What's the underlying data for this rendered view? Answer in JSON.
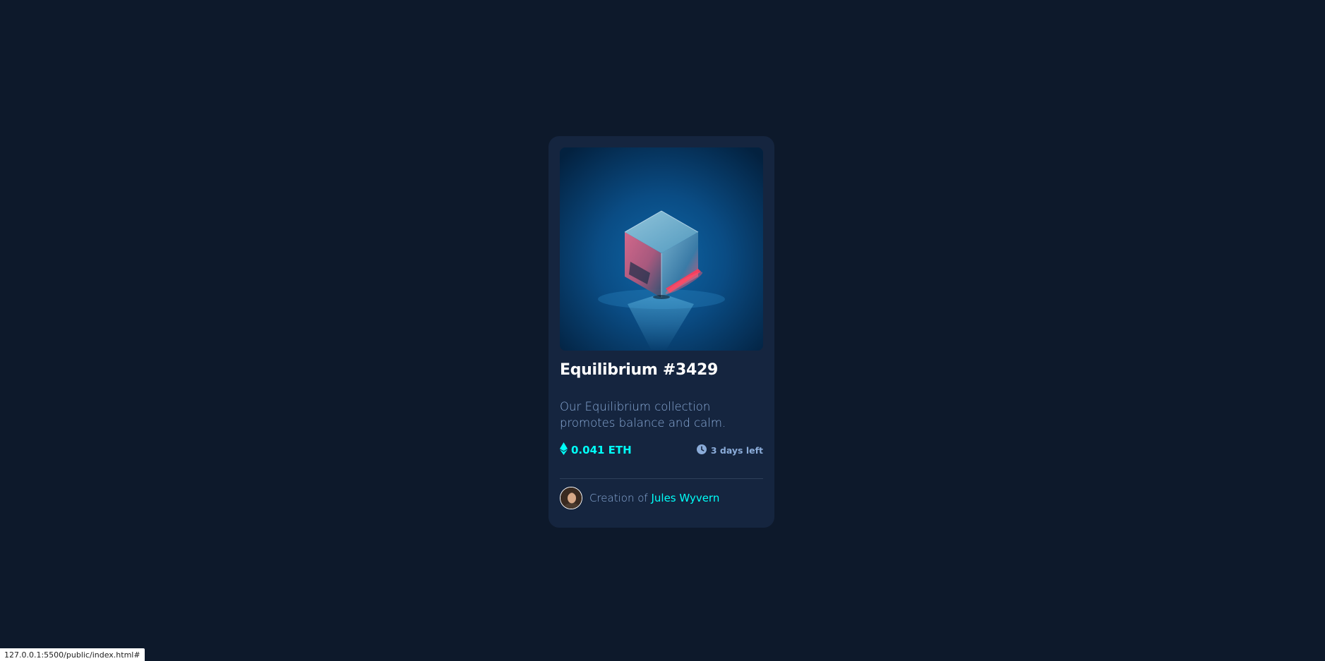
{
  "card": {
    "title": "Equilibrium #3429",
    "description": "Our Equilibrium collection promotes balance and calm.",
    "image_icon": "crystal-cube-image",
    "price": "0.041 ETH",
    "time_left": "3 days left",
    "creator_prefix": "Creation of ",
    "creator_name": "Jules Wyvern"
  },
  "colors": {
    "page_bg": "#0d192b",
    "card_bg": "#15253f",
    "accent_cyan": "#00fff8",
    "soft_blue": "#8bacd9",
    "white": "#ffffff",
    "divider": "#2e405a"
  },
  "status_bar": {
    "url": "127.0.0.1:5500/public/index.html#"
  }
}
